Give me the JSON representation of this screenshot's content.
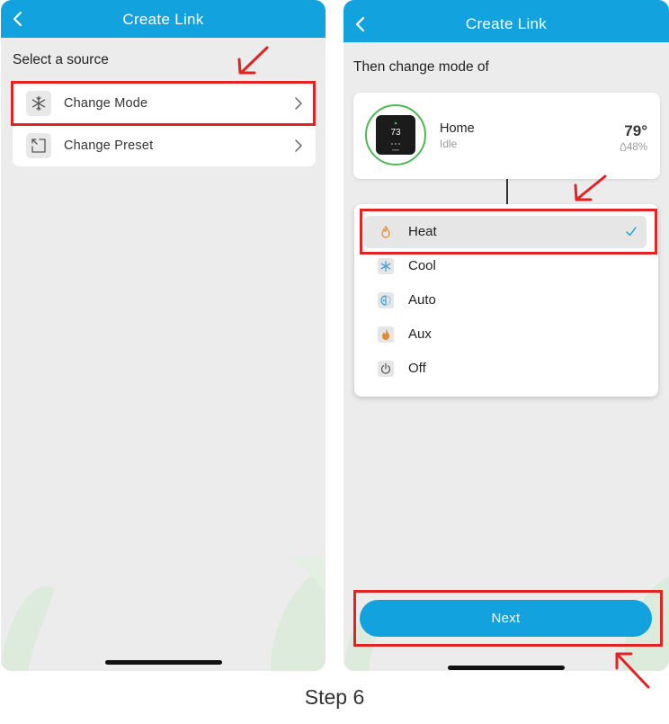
{
  "left_screen": {
    "header_title": "Create Link",
    "prompt": "Select a source",
    "sources": [
      {
        "label": "Change Mode",
        "icon": "snowflake-icon"
      },
      {
        "label": "Change Preset",
        "icon": "preset-icon"
      }
    ]
  },
  "right_screen": {
    "header_title": "Create Link",
    "prompt": "Then change mode of",
    "device": {
      "name": "Home",
      "status": "Idle",
      "temperature": "79°",
      "humidity": "48%",
      "display_temp": "73"
    },
    "modes": [
      {
        "label": "Heat",
        "icon": "heat-flame-icon",
        "selected": true
      },
      {
        "label": "Cool",
        "icon": "cool-snowflake-icon",
        "selected": false
      },
      {
        "label": "Auto",
        "icon": "auto-icon",
        "selected": false
      },
      {
        "label": "Aux",
        "icon": "aux-flame-icon",
        "selected": false
      },
      {
        "label": "Off",
        "icon": "power-icon",
        "selected": false
      }
    ],
    "next_label": "Next"
  },
  "caption": "Step 6",
  "colors": {
    "header": "#12a3de",
    "background": "#ececec",
    "highlight": "#e32222",
    "device_ring": "#4cbb4f",
    "heat_icon": "#e88a2c",
    "cool_icon": "#3a9bd8"
  }
}
